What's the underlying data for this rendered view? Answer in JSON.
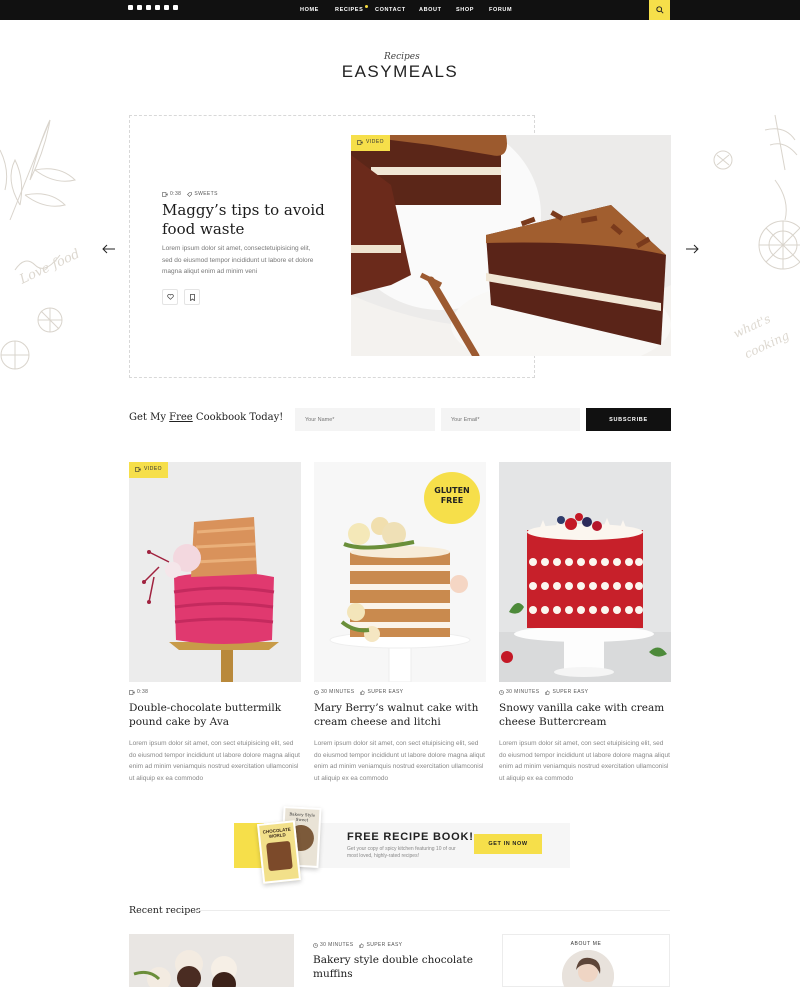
{
  "topbar": {
    "social_icons": [
      "instagram-icon",
      "twitter-icon",
      "facebook-icon",
      "pinterest-icon",
      "rss-icon",
      "youtube-icon"
    ],
    "nav": [
      {
        "label": "HOME"
      },
      {
        "label": "RECIPES"
      },
      {
        "label": "CONTACT"
      },
      {
        "label": "ABOUT"
      },
      {
        "label": "SHOP"
      },
      {
        "label": "FORUM"
      }
    ],
    "search_icon": "search-icon"
  },
  "logo": {
    "script": "Recipes",
    "name": "EASYMEALS"
  },
  "hero": {
    "meta_time": "0:38",
    "meta_category": "SWEETS",
    "title": "Maggy’s tips to avoid food waste",
    "text": "Lorem ipsum dolor sit amet, consectetuipisicing elit, sed do eiusmod tempor incididunt ut labore et dolore magna aliqut enim ad minim veni",
    "tag": "VIDEO"
  },
  "subscribe": {
    "title_prefix": "Get My ",
    "title_underlined": "Free",
    "title_suffix": " Cookbook Today!",
    "name_placeholder": "Your Name*",
    "email_placeholder": "Your Email*",
    "button": "SUBSCRIBE"
  },
  "cards": [
    {
      "tag": "VIDEO",
      "meta_time": "0:38",
      "meta_level": "",
      "title": "Double-chocolate buttermilk pound cake by Ava",
      "text": "Lorem ipsum dolor sit amet, con sect etuipisicing elit, sed do eiusmod tempor incididunt ut labore dolore magna aliqut enim ad minim veniamquis nostrud exercitation ullamconisl ut aliquip ex ea commodo"
    },
    {
      "tag": "",
      "badge": "GLUTEN FREE",
      "meta_time": "30 MINUTES",
      "meta_level": "SUPER EASY",
      "title": "Mary Berry’s walnut cake with cream cheese and litchi",
      "text": "Lorem ipsum dolor sit amet, con sect etuipisicing elit, sed do eiusmod tempor incididunt ut labore dolore magna aliqut enim ad minim veniamquis nostrud exercitation ullamconisl ut aliquip ex ea commodo"
    },
    {
      "tag": "",
      "meta_time": "30 MINUTES",
      "meta_level": "SUPER EASY",
      "title": "Snowy vanilla cake with cream cheese Buttercream",
      "text": "Lorem ipsum dolor sit amet, con sect etuipisicing elit, sed do eiusmod tempor incididunt ut labore dolore magna aliqut enim ad minim veniamquis nostrud exercitation ullamconisl ut aliquip ex ea commodo"
    }
  ],
  "book_banner": {
    "title": "FREE RECIPE BOOK!",
    "subtitle": "Get your copy of spicy kitchen featuring 10 of our most loved, highly-rated recipes!",
    "button": "GET IN NOW",
    "book_front_title": "CHOCOLATE WORLD",
    "book_back_title": "Bakery Style Sweet"
  },
  "recent": {
    "section_title": "Recent recipes",
    "meta_time": "30 MINUTES",
    "meta_level": "SUPER EASY",
    "title": "Bakery style double chocolate muffins",
    "about_label": "ABOUT ME"
  },
  "colors": {
    "accent": "#f6df4a",
    "dark": "#111111"
  }
}
